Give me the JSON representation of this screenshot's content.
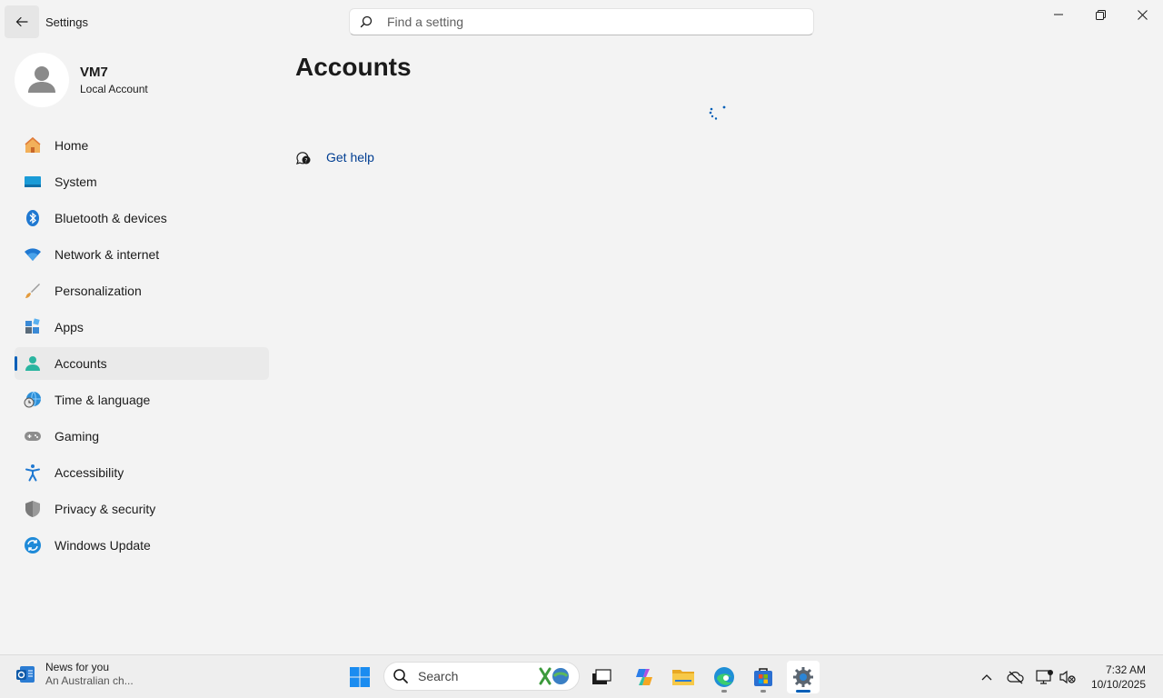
{
  "window": {
    "title": "Settings",
    "controls": [
      "minimize",
      "restore",
      "close"
    ]
  },
  "search": {
    "placeholder": "Find a setting",
    "value": ""
  },
  "profile": {
    "name": "VM7",
    "account_type": "Local Account"
  },
  "nav": {
    "items": [
      {
        "label": "Home",
        "icon": "home-icon"
      },
      {
        "label": "System",
        "icon": "system-icon"
      },
      {
        "label": "Bluetooth & devices",
        "icon": "bluetooth-icon"
      },
      {
        "label": "Network & internet",
        "icon": "wifi-icon"
      },
      {
        "label": "Personalization",
        "icon": "brush-icon"
      },
      {
        "label": "Apps",
        "icon": "apps-icon"
      },
      {
        "label": "Accounts",
        "icon": "accounts-icon",
        "active": true
      },
      {
        "label": "Time & language",
        "icon": "globe-clock-icon"
      },
      {
        "label": "Gaming",
        "icon": "gamepad-icon"
      },
      {
        "label": "Accessibility",
        "icon": "accessibility-icon"
      },
      {
        "label": "Privacy & security",
        "icon": "shield-icon"
      },
      {
        "label": "Windows Update",
        "icon": "update-icon"
      }
    ]
  },
  "main": {
    "title": "Accounts",
    "help_label": "Get help"
  },
  "taskbar": {
    "news_title": "News for you",
    "news_subtitle": "An Australian ch...",
    "search_label": "Search",
    "time": "7:32 AM",
    "date": "10/10/2025"
  },
  "colors": {
    "accent": "#005fb8",
    "link": "#003e92",
    "background": "#f3f3f3"
  }
}
